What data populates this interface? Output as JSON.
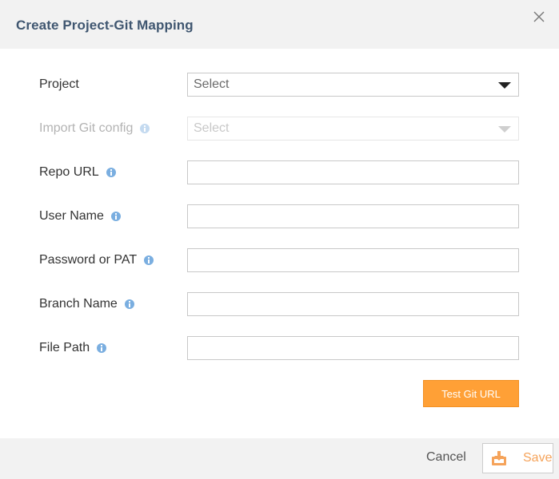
{
  "dialog": {
    "title": "Create Project-Git Mapping"
  },
  "form": {
    "project": {
      "label": "Project",
      "value": "Select"
    },
    "import_git_config": {
      "label": "Import Git config",
      "value": "Select",
      "disabled": true
    },
    "repo_url": {
      "label": "Repo URL",
      "value": ""
    },
    "user_name": {
      "label": "User Name",
      "value": ""
    },
    "password": {
      "label": "Password or PAT",
      "value": ""
    },
    "branch_name": {
      "label": "Branch Name",
      "value": ""
    },
    "file_path": {
      "label": "File Path",
      "value": ""
    }
  },
  "actions": {
    "test_label": "Test Git URL",
    "cancel_label": "Cancel",
    "save_label": "Save"
  },
  "colors": {
    "accent": "#ffa036",
    "title": "#3f5670",
    "info_icon": "#7aaee0"
  }
}
